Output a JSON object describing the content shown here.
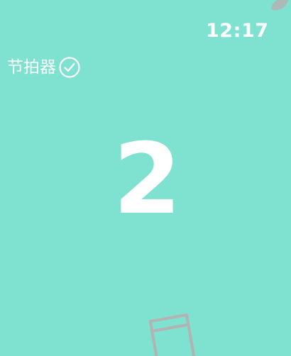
{
  "status_bar": {
    "time": "12:17"
  },
  "header": {
    "title": "节拍器",
    "check_icon": "checkmark-circle-icon"
  },
  "metronome": {
    "current_beat": "2"
  },
  "decorations": {
    "corner_icon": "leaf-icon",
    "bottom_icon": "sheet-music-stand-icon"
  },
  "colors": {
    "background": "#7fe1cf",
    "foreground": "#ffffff",
    "muted_icon": "#b3b3b3"
  }
}
